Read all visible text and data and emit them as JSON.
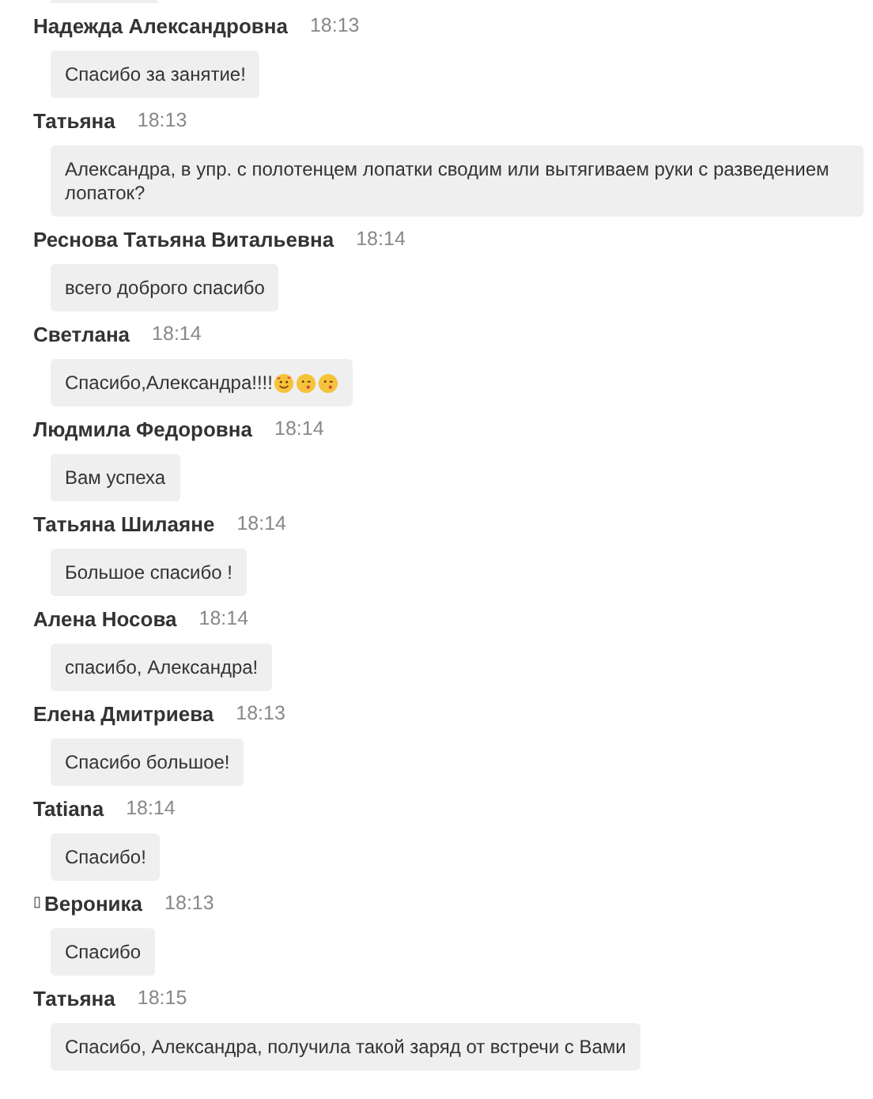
{
  "messages": [
    {
      "author": "Надежда Александровна",
      "time": "18:13",
      "text": "Спасибо за занятие!"
    },
    {
      "author": "Татьяна",
      "time": "18:13",
      "text": "Александра, в упр. с полотенцем лопатки сводим или вытягиваем руки с разведением лопаток?"
    },
    {
      "author": "Реснова Татьяна Витальевна",
      "time": "18:14",
      "text": "всего доброго спасибо"
    },
    {
      "author": "Светлана",
      "time": "18:14",
      "text": "Спасибо,Александра!!!!",
      "emojis": [
        {
          "kind": "hearts"
        },
        {
          "kind": "kiss"
        },
        {
          "kind": "kiss"
        }
      ]
    },
    {
      "author": "Людмила Федоровна",
      "time": "18:14",
      "text": "Вам успеха"
    },
    {
      "author": "Татьяна Шилаяне",
      "time": "18:14",
      "text": "Большое спасибо !"
    },
    {
      "author": "Алена Носова",
      "time": "18:14",
      "text": "спасибо, Александра!"
    },
    {
      "author": "Елена Дмитриева",
      "time": "18:13",
      "text": "Спасибо большое!"
    },
    {
      "author": "Tatiana",
      "time": "18:14",
      "text": "Спасибо!"
    },
    {
      "author": "Вероника",
      "time": "18:13",
      "text": "Спасибо",
      "author_prefix": "▯"
    },
    {
      "author": "Татьяна",
      "time": "18:15",
      "text": "Спасибо, Александра, получила такой заряд от встречи с Вами"
    }
  ]
}
